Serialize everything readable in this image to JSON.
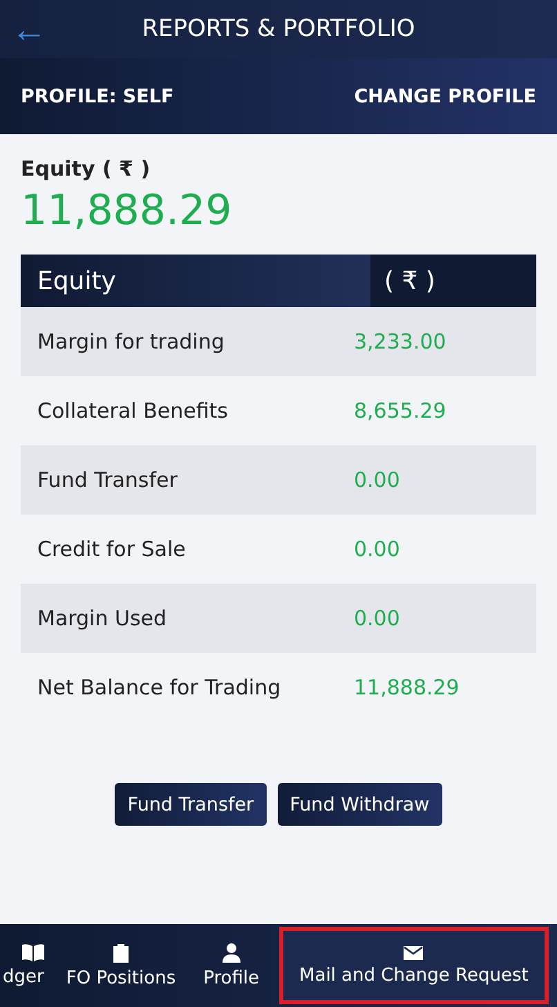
{
  "header": {
    "back": "←",
    "title": "REPORTS & PORTFOLIO"
  },
  "profile_bar": {
    "profile": "PROFILE: SELF",
    "action": "CHANGE PROFILE"
  },
  "summary": {
    "label": "Equity ( ₹ )",
    "value": "11,888.29"
  },
  "table": {
    "columns": [
      "Equity",
      "( ₹ )"
    ],
    "rows": [
      {
        "label": "Margin for trading",
        "value": "3,233.00"
      },
      {
        "label": "Collateral Benefits",
        "value": "8,655.29"
      },
      {
        "label": "Fund Transfer",
        "value": "0.00"
      },
      {
        "label": "Credit for Sale",
        "value": "0.00"
      },
      {
        "label": "Margin Used",
        "value": "0.00"
      },
      {
        "label": "Net Balance for Trading",
        "value": "11,888.29"
      }
    ]
  },
  "buttons": [
    "Fund Transfer",
    "Fund Withdraw"
  ],
  "bottom_nav": [
    {
      "label": "dger",
      "kind": "book",
      "selected": false
    },
    {
      "label": "FO Positions",
      "kind": "clipboard",
      "selected": false
    },
    {
      "label": "Profile",
      "kind": "person",
      "selected": false
    },
    {
      "label": "Mail and Change Request",
      "kind": "mail",
      "selected": true
    }
  ]
}
